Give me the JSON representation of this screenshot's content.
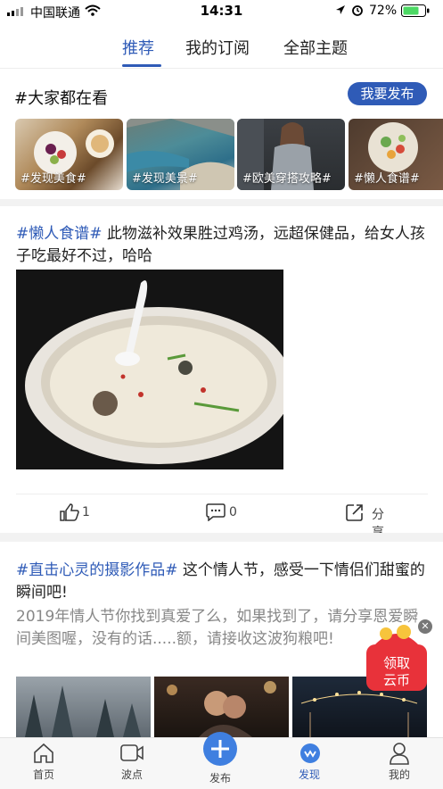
{
  "status_bar": {
    "carrier": "中国联通",
    "time": "14:31",
    "battery": "72%"
  },
  "tabs": [
    {
      "label": "推荐",
      "active": true
    },
    {
      "label": "我的订阅",
      "active": false
    },
    {
      "label": "全部主题",
      "active": false
    }
  ],
  "trending": {
    "title": "#大家都在看",
    "publish_button": "我要发布",
    "topics": [
      {
        "label": "#发现美食#"
      },
      {
        "label": "#发现美景#"
      },
      {
        "label": "#欧美穿搭攻略#"
      },
      {
        "label": "#懒人食谱#"
      }
    ]
  },
  "posts": [
    {
      "tag": "#懒人食谱#",
      "title": " 此物滋补效果胜过鸡汤，远超保健品，给女人孩子吃最好不过，哈哈",
      "likes": "1",
      "comments": "0",
      "share_label": "分享"
    },
    {
      "tag": "#直击心灵的摄影作品#",
      "title": " 这个情人节，感受一下情侣们甜蜜的瞬间吧!",
      "body": "2019年情人节你找到真爱了么，如果找到了，请分享恩爱瞬间美图喔，没有的话.....额，请接收这波狗粮吧!"
    }
  ],
  "coin_badge": {
    "line1": "领取",
    "line2": "云币"
  },
  "bottom_nav": [
    {
      "label": "首页",
      "icon": "home-icon"
    },
    {
      "label": "波点",
      "icon": "video-icon"
    },
    {
      "label": "发布",
      "icon": "plus-icon"
    },
    {
      "label": "发现",
      "icon": "discover-icon",
      "active": true
    },
    {
      "label": "我的",
      "icon": "profile-icon"
    }
  ],
  "colors": {
    "accent": "#2f5bb7",
    "coin_red": "#e8323a"
  }
}
